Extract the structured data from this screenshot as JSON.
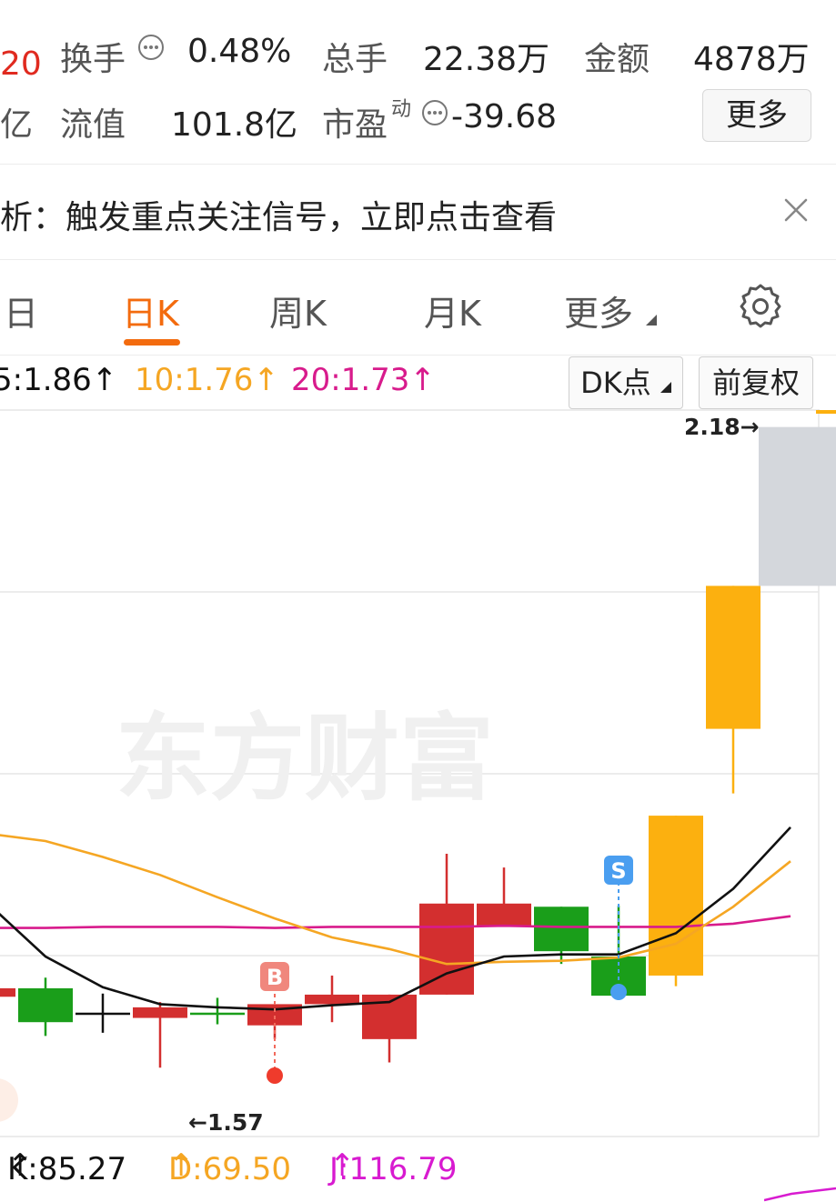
{
  "stats": {
    "row1": {
      "left_fragment": "20",
      "turnover_label": "换手",
      "turnover_value": "0.48%",
      "volume_label": "总手",
      "volume_value": "22.38万",
      "amount_label": "金额",
      "amount_value": "4878万"
    },
    "row2": {
      "left_fragment": "亿",
      "float_label": "流值",
      "float_value": "101.8亿",
      "pe_label": "市盈",
      "pe_sup": "动",
      "pe_value": "-39.68",
      "more_label": "更多"
    }
  },
  "notice": {
    "text": "析：触发重点关注信号，立即点击查看",
    "close_icon": "close-icon"
  },
  "tabs": {
    "items": [
      "日",
      "日K",
      "周K",
      "月K",
      "更多"
    ],
    "active_index": 1,
    "settings_icon": "gear-icon"
  },
  "ma": {
    "ma5": "5:1.86",
    "ma10": "10:1.76",
    "ma20": "20:1.73",
    "dk_label": "DK点",
    "adjust_label": "前复权",
    "colors": {
      "ma5": "#111111",
      "ma10": "#f5a623",
      "ma20": "#d81b8c"
    }
  },
  "chart_data": {
    "type": "candlestick",
    "watermark": "东方财富",
    "high_label": "2.18",
    "low_label": "1.57",
    "buy_marker": "B",
    "sell_marker": "S",
    "ylim": [
      1.51,
      2.19
    ],
    "colors": {
      "up": "#d32f2f",
      "down": "#1a9e1a",
      "limit_up": "#fcb00f",
      "flat": "#111111"
    },
    "candles": [
      {
        "open": 1.642,
        "close": 1.65,
        "high": 1.65,
        "low": 1.64,
        "kind": "up"
      },
      {
        "open": 1.65,
        "close": 1.618,
        "high": 1.66,
        "low": 1.605,
        "kind": "down"
      },
      {
        "open": 1.627,
        "close": 1.627,
        "high": 1.645,
        "low": 1.608,
        "kind": "flat"
      },
      {
        "open": 1.632,
        "close": 1.622,
        "high": 1.637,
        "low": 1.575,
        "kind": "up"
      },
      {
        "open": 1.627,
        "close": 1.627,
        "high": 1.641,
        "low": 1.616,
        "kind": "down"
      },
      {
        "open": 1.615,
        "close": 1.635,
        "high": 1.632,
        "low": 1.602,
        "kind": "up"
      },
      {
        "open": 1.635,
        "close": 1.644,
        "high": 1.662,
        "low": 1.618,
        "kind": "up"
      },
      {
        "open": 1.602,
        "close": 1.644,
        "high": 1.644,
        "low": 1.58,
        "kind": "up"
      },
      {
        "open": 1.644,
        "close": 1.73,
        "high": 1.777,
        "low": 1.644,
        "kind": "up"
      },
      {
        "open": 1.708,
        "close": 1.73,
        "high": 1.764,
        "low": 1.708,
        "kind": "up"
      },
      {
        "open": 1.727,
        "close": 1.685,
        "high": 1.727,
        "low": 1.673,
        "kind": "down"
      },
      {
        "open": 1.68,
        "close": 1.643,
        "high": 1.728,
        "low": 1.643,
        "kind": "down"
      },
      {
        "open": 1.662,
        "close": 1.813,
        "high": 1.813,
        "low": 1.652,
        "kind": "limit_up"
      },
      {
        "open": 1.895,
        "close": 2.03,
        "high": 2.03,
        "low": 1.834,
        "kind": "limit_up"
      },
      {
        "open": 2.03,
        "close": 2.18,
        "high": 2.18,
        "low": 2.03,
        "kind": "pending"
      }
    ],
    "ma5": [
      1.73,
      1.68,
      1.651,
      1.635,
      1.632,
      1.63,
      1.634,
      1.637,
      1.664,
      1.68,
      1.682,
      1.682,
      1.702,
      1.744,
      1.802
    ],
    "ma10": [
      1.796,
      1.789,
      1.774,
      1.757,
      1.736,
      1.716,
      1.698,
      1.687,
      1.673,
      1.675,
      1.676,
      1.679,
      1.692,
      1.727,
      1.77
    ],
    "ma20": [
      1.707,
      1.707,
      1.708,
      1.708,
      1.708,
      1.707,
      1.708,
      1.708,
      1.708,
      1.709,
      1.708,
      1.708,
      1.708,
      1.711,
      1.718
    ]
  },
  "kdj": {
    "k": "K:85.27",
    "d": "D:69.50",
    "j": "J:116.79",
    "colors": {
      "k": "#111111",
      "d": "#f5a623",
      "j": "#d81bd0"
    }
  }
}
